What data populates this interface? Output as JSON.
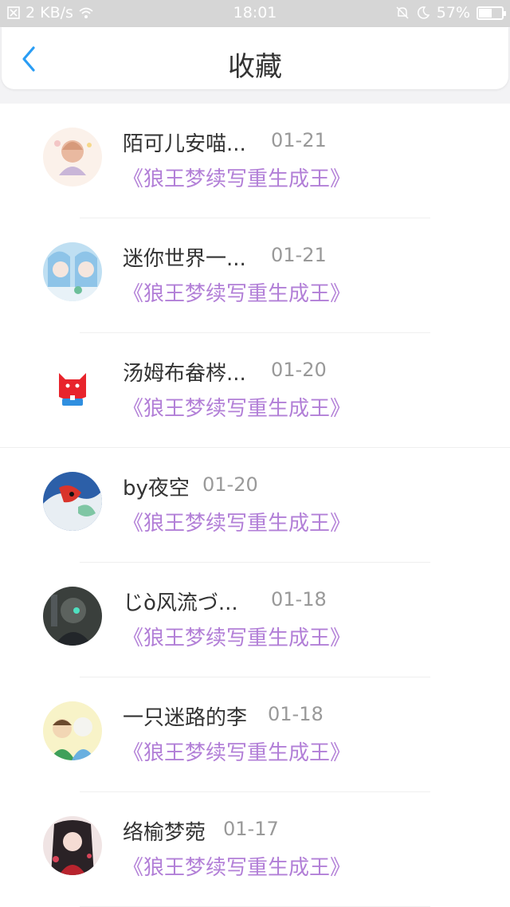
{
  "status_bar": {
    "speed": "2 KB/s",
    "time": "18:01",
    "battery": "57%",
    "battery_level": 0.57
  },
  "header": {
    "title": "收藏"
  },
  "items": [
    {
      "name": "陌可儿安喵...",
      "date": "01-21",
      "book": "《狼王梦续写重生成王》"
    },
    {
      "name": "迷你世界一...",
      "date": "01-21",
      "book": "《狼王梦续写重生成王》"
    },
    {
      "name": "汤姆布畚梣...",
      "date": "01-20",
      "book": "《狼王梦续写重生成王》"
    },
    {
      "name": "by夜空",
      "date": "01-20",
      "book": "《狼王梦续写重生成王》"
    },
    {
      "name": "じò风流づ...",
      "date": "01-18",
      "book": "《狼王梦续写重生成王》"
    },
    {
      "name": "一只迷路的李",
      "date": "01-18",
      "book": "《狼王梦续写重生成王》"
    },
    {
      "name": "络榆梦菀",
      "date": "01-17",
      "book": "《狼王梦续写重生成王》"
    }
  ],
  "colors": {
    "book_title": "#b27fd7",
    "accent": "#2a9df4"
  }
}
